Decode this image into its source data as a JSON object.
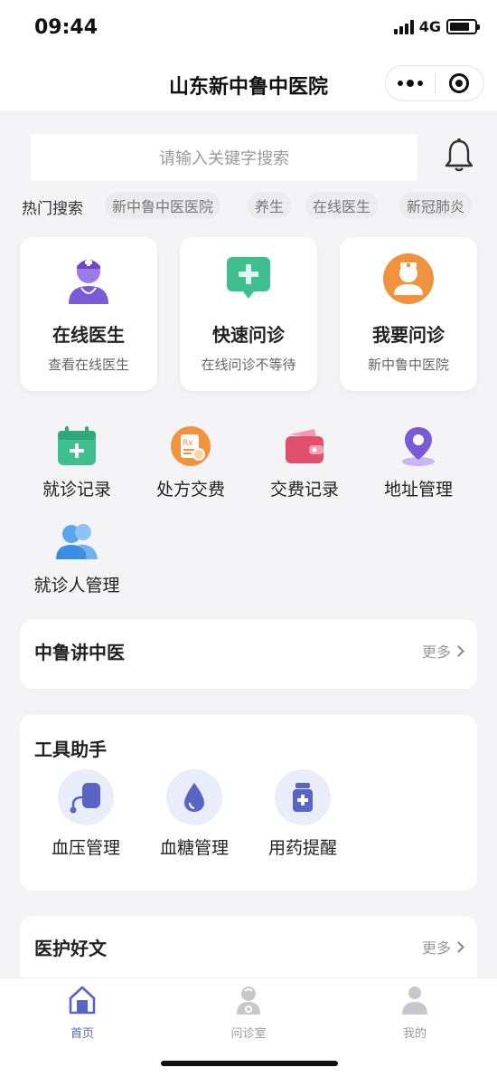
{
  "status": {
    "time": "09:44",
    "network": "4G",
    "battery_level": 0.8
  },
  "nav": {
    "title": "山东新中鲁中医院"
  },
  "search": {
    "placeholder": "请输入关键字搜索"
  },
  "hot": {
    "label": "热门搜索",
    "tags": [
      "新中鲁中医医院",
      "养生",
      "在线医生",
      "新冠肺炎"
    ]
  },
  "feature_cards": [
    {
      "title": "在线医生",
      "subtitle": "查看在线医生",
      "icon": "doctor-icon"
    },
    {
      "title": "快速问诊",
      "subtitle": "在线问诊不等待",
      "icon": "chat-plus-icon"
    },
    {
      "title": "我要问诊",
      "subtitle": "新中鲁中医院",
      "icon": "nurse-avatar-icon"
    }
  ],
  "services": [
    {
      "label": "就诊记录",
      "icon": "calendar-record-icon"
    },
    {
      "label": "处方交费",
      "icon": "prescription-icon"
    },
    {
      "label": "交费记录",
      "icon": "wallet-icon"
    },
    {
      "label": "地址管理",
      "icon": "location-pin-icon"
    },
    {
      "label": "就诊人管理",
      "icon": "patients-icon"
    }
  ],
  "section_tcm": {
    "title": "中鲁讲中医",
    "more": "更多"
  },
  "tools": {
    "title": "工具助手",
    "items": [
      {
        "label": "血压管理",
        "icon": "blood-pressure-icon"
      },
      {
        "label": "血糖管理",
        "icon": "blood-drop-icon"
      },
      {
        "label": "用药提醒",
        "icon": "medicine-bottle-icon"
      }
    ]
  },
  "section_articles": {
    "title": "医护好文",
    "more": "更多"
  },
  "tabbar": [
    {
      "label": "首页",
      "icon": "home-icon",
      "active": true
    },
    {
      "label": "问诊室",
      "icon": "consult-room-icon",
      "active": false
    },
    {
      "label": "我的",
      "icon": "profile-icon",
      "active": false
    }
  ],
  "colors": {
    "accent": "#5964c4",
    "background": "#f4f4f6",
    "green": "#3fbf8f",
    "orange": "#f0933f",
    "purple": "#7b5ad6",
    "red": "#e0506e",
    "blue": "#3c8fe0"
  }
}
